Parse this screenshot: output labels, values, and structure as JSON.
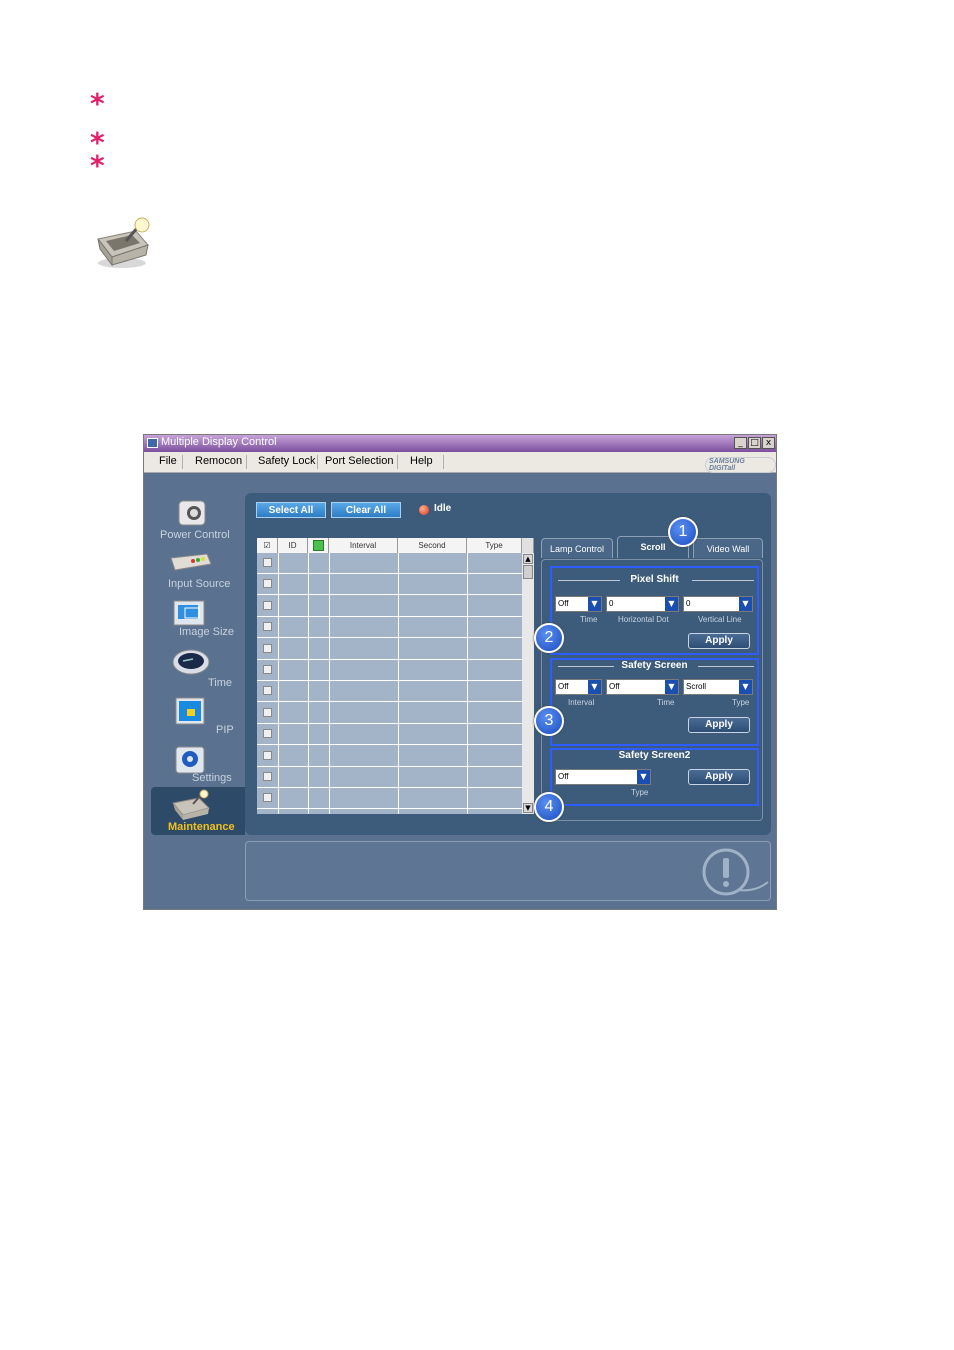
{
  "doc": {
    "stars": [
      "*",
      "*",
      "*"
    ]
  },
  "window": {
    "title": "Multiple Display Control",
    "controls": {
      "minimize": "_",
      "maximize": "□",
      "close": "x"
    },
    "brand": "SAMSUNG DIGITall"
  },
  "menu": {
    "items": [
      "File",
      "Remocon",
      "Safety Lock",
      "Port Selection",
      "Help"
    ]
  },
  "sidebar": {
    "items": [
      {
        "label": "Power Control",
        "icon": "power-control-icon"
      },
      {
        "label": "Input Source",
        "icon": "input-source-icon"
      },
      {
        "label": "Image Size",
        "icon": "image-size-icon"
      },
      {
        "label": "Time",
        "icon": "clock-icon"
      },
      {
        "label": "PIP",
        "icon": "pip-icon"
      },
      {
        "label": "Settings",
        "icon": "settings-icon"
      },
      {
        "label": "Maintenance",
        "icon": "maintenance-icon",
        "selected": true
      }
    ]
  },
  "toolbar": {
    "select_all": "Select All",
    "clear_all": "Clear All",
    "status": "Idle",
    "status_color": "#e03020"
  },
  "grid": {
    "columns": [
      "☑",
      "ID",
      "",
      "Interval",
      "Second",
      "Type"
    ],
    "row_count": 12
  },
  "tabs": {
    "items": [
      "Lamp Control",
      "Scroll",
      "Video Wall"
    ],
    "active": "Scroll"
  },
  "pixel_shift": {
    "title": "Pixel Shift",
    "time": {
      "value": "Off",
      "label": "Time"
    },
    "horizontal_dot": {
      "value": "0",
      "label": "Horizontal Dot"
    },
    "vertical_line": {
      "value": "0",
      "label": "Vertical Line"
    },
    "apply": "Apply"
  },
  "safety_screen": {
    "title": "Safety Screen",
    "interval": {
      "value": "Off",
      "label": "Interval"
    },
    "time": {
      "value": "Off",
      "label": "Time"
    },
    "type": {
      "value": "Scroll",
      "label": "Type"
    },
    "apply": "Apply"
  },
  "safety_screen2": {
    "title": "Safety Screen2",
    "type": {
      "value": "Off",
      "label": "Type"
    },
    "apply": "Apply"
  },
  "callouts": [
    "1",
    "2",
    "3",
    "4"
  ],
  "colors": {
    "accent_star": "#e2206b",
    "window_bg": "#5a7290",
    "panel_bg": "#3d5c7b",
    "callout_blue": "#1b4dc2",
    "highlight_border": "#2f5cff"
  }
}
